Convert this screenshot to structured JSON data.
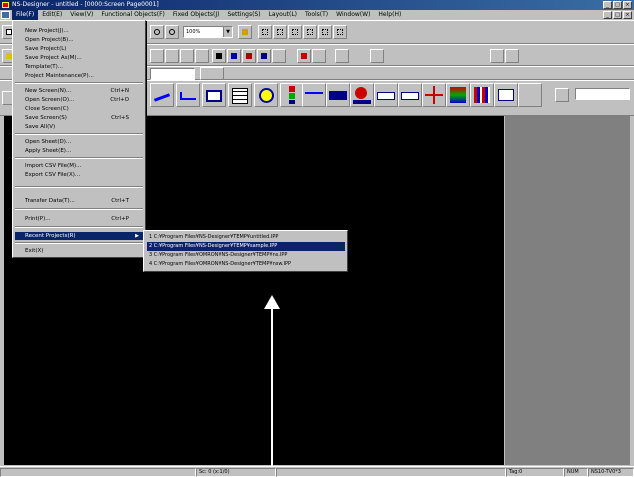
{
  "window": {
    "title": "NS-Designer - untitled - [0000:Screen Page0001]"
  },
  "menubar": {
    "items": [
      "File(F)",
      "Edit(E)",
      "View(V)",
      "Functional Objects(F)",
      "Fixed Objects(J)",
      "Settings(S)",
      "Layout(L)",
      "Tools(T)",
      "Window(W)",
      "Help(H)"
    ]
  },
  "toolbar": {
    "zoom_value": "100%",
    "layer_value": ""
  },
  "file_menu": {
    "items": [
      {
        "label": "New Project(J)...",
        "shortcut": ""
      },
      {
        "label": "Open Project(B)...",
        "shortcut": ""
      },
      {
        "label": "Save Project(L)",
        "shortcut": ""
      },
      {
        "label": "Save Project As(M)...",
        "shortcut": ""
      },
      {
        "label": "Template(T)...",
        "shortcut": ""
      },
      {
        "label": "Project Maintenance(P)...",
        "shortcut": ""
      },
      {
        "label": "New Screen(N)...",
        "shortcut": "Ctrl+N"
      },
      {
        "label": "Open Screen(O)...",
        "shortcut": "Ctrl+O"
      },
      {
        "label": "Close Screen(C)",
        "shortcut": ""
      },
      {
        "label": "Save Screen(S)",
        "shortcut": "Ctrl+S"
      },
      {
        "label": "Save All(V)",
        "shortcut": ""
      },
      {
        "label": "Open Sheet(D)...",
        "shortcut": ""
      },
      {
        "label": "Apply Sheet(E)...",
        "shortcut": ""
      },
      {
        "label": "Import CSV File(M)...",
        "shortcut": ""
      },
      {
        "label": "Export CSV File(X)...",
        "shortcut": ""
      },
      {
        "label": "Transfer Data(T)...",
        "shortcut": "Ctrl+T"
      },
      {
        "label": "Print(P)...",
        "shortcut": "Ctrl+P"
      },
      {
        "label": "Recent Projects(R)",
        "shortcut": ""
      },
      {
        "label": "Exit(X)",
        "shortcut": ""
      }
    ]
  },
  "recent_projects": {
    "items": [
      "1 C:¥Program Files¥NS-Designer¥TEMP¥untitled.IPP",
      "2 C:¥Program Files¥NS-Designer¥TEMP¥sample.IPP",
      "3 C:¥Program Files¥OMRON¥NS-Designer¥TEMP¥ns.IPP",
      "4 C:¥Program Files¥OMRON¥NS-Designer¥TEMP¥nsw.IPP"
    ]
  },
  "statusbar": {
    "coords": "Sc: 0 (x:1/0)",
    "mode": "Tag:0",
    "num": "NUM",
    "model": "NS10-TV0*3"
  },
  "colors": {
    "titlebar": "#0a246a",
    "highlight": "#0a246a",
    "workspace": "#000000",
    "panel": "#c0c0c0"
  }
}
